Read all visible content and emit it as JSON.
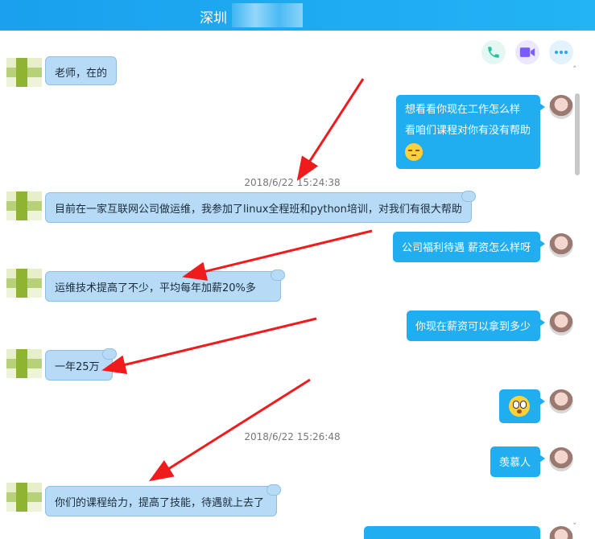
{
  "window": {
    "title": "深圳"
  },
  "toolbar": {
    "phone_icon": "phone-icon",
    "video_icon": "video-icon",
    "more_icon": "more-icon",
    "colors": {
      "phone": "#25c2a0",
      "video": "#7b5cff",
      "more": "#22a8f0"
    }
  },
  "messages": {
    "m1": "老师，在的",
    "m2_line1": "想看看你现在工作怎么样",
    "m2_line2": "看咱们课程对你有没有帮助",
    "ts1": "2018/6/22 15:24:38",
    "m3": "目前在一家互联网公司做运维，我参加了linux全程班和python培训，对我们有很大帮助",
    "m4": "公司福利待遇 薪资怎么样呀",
    "m5": "运维技术提高了不少，平均每年加薪20%多",
    "m6": "你现在薪资可以拿到多少",
    "m7": "一年25万",
    "ts2": "2018/6/22 15:26:48",
    "m9": "羡慕人",
    "m10": "你们的课程给力，提高了技能，待遇就上去了"
  },
  "scrollbar": {
    "up": "˄",
    "down": "˅"
  },
  "colors": {
    "outgoing": "#20aef0",
    "incoming": "#b7dbf7",
    "arrow": "#ee1c1c"
  }
}
